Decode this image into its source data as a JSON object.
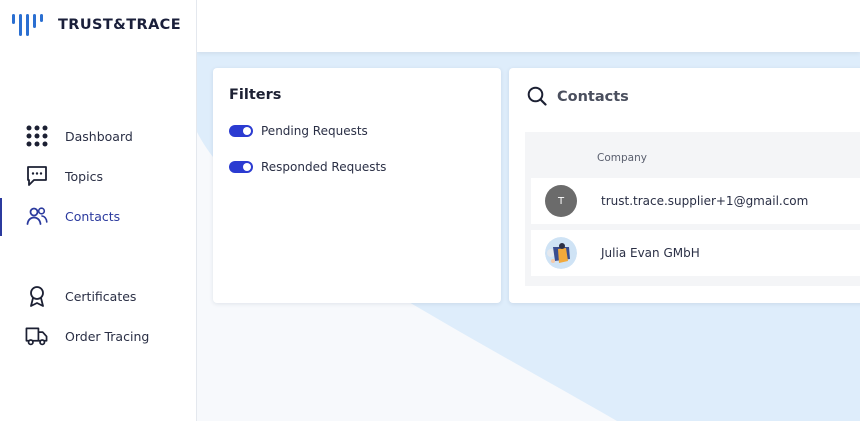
{
  "brand": {
    "name": "TRUST&TRACE"
  },
  "sidebar": {
    "items": [
      {
        "label": "Dashboard",
        "icon": "dashboard-grid-icon"
      },
      {
        "label": "Topics",
        "icon": "chat-bubble-icon"
      },
      {
        "label": "Contacts",
        "icon": "contacts-people-icon",
        "active": true
      },
      {
        "label": "Certificates",
        "icon": "badge-ribbon-icon"
      },
      {
        "label": "Order Tracing",
        "icon": "truck-icon"
      }
    ]
  },
  "filters": {
    "title": "Filters",
    "toggles": [
      {
        "label": "Pending Requests",
        "on": true
      },
      {
        "label": "Responded Requests",
        "on": true
      }
    ]
  },
  "contacts": {
    "title": "Contacts",
    "column_company": "Company",
    "rows": [
      {
        "avatar_letter": "T",
        "company": "trust.trace.supplier+1@gmail.com"
      },
      {
        "avatar_letter": "",
        "company": "Julia Evan GMbH"
      }
    ]
  },
  "colors": {
    "accent": "#2b3bd1",
    "active_nav": "#2b3a9e"
  }
}
